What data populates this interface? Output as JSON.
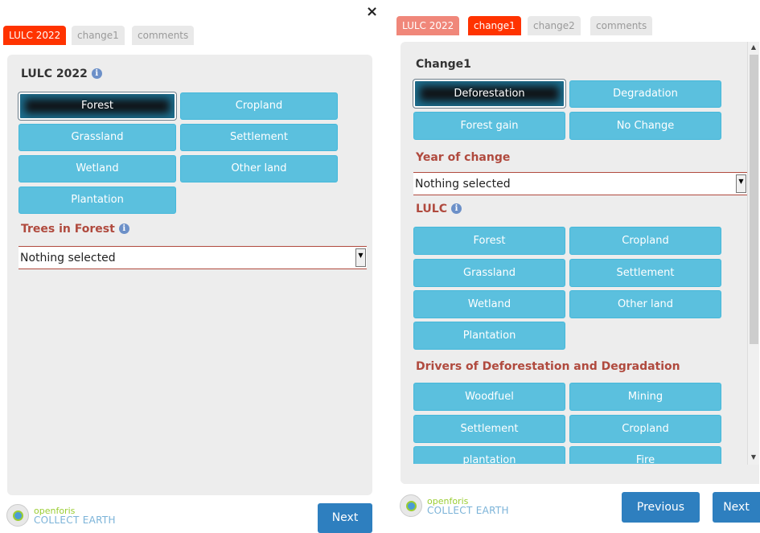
{
  "left": {
    "tabs": [
      {
        "label": "LULC 2022",
        "state": "active"
      },
      {
        "label": "change1",
        "state": "inactive"
      },
      {
        "label": "comments",
        "state": "inactive"
      }
    ],
    "section_title": "LULC 2022",
    "buttons": [
      "Forest",
      "Cropland",
      "Grassland",
      "Settlement",
      "Wetland",
      "Other land",
      "Plantation"
    ],
    "selected_button": "Forest",
    "trees_title": "Trees in Forest",
    "trees_select_value": "Nothing selected",
    "next_label": "Next"
  },
  "close_symbol": "×",
  "right": {
    "tabs": [
      {
        "label": "LULC 2022",
        "state": "visited"
      },
      {
        "label": "change1",
        "state": "active"
      },
      {
        "label": "change2",
        "state": "inactive"
      },
      {
        "label": "comments",
        "state": "inactive"
      }
    ],
    "section_title": "Change1",
    "change_buttons": [
      "Deforestation",
      "Degradation",
      "Forest gain",
      "No Change"
    ],
    "selected_change": "Deforestation",
    "year_title": "Year of change",
    "year_select_value": "Nothing selected",
    "lulc_title": "LULC",
    "lulc_buttons": [
      "Forest",
      "Cropland",
      "Grassland",
      "Settlement",
      "Wetland",
      "Other land",
      "Plantation"
    ],
    "drivers_title": "Drivers of Deforestation and Degradation",
    "driver_buttons": [
      "Woodfuel",
      "Mining",
      "Settlement",
      "Cropland",
      "plantation",
      "Fire"
    ],
    "previous_label": "Previous",
    "next_label": "Next"
  },
  "logo": {
    "line1": "openforis",
    "line2": "COLLECT EARTH"
  },
  "info_icon": "i",
  "colors": {
    "tab_active": "#ff3300",
    "button": "#5bc0de",
    "nav_button": "#2e7fbf",
    "section_red": "#b04a3e",
    "panel_bg": "#ededed"
  }
}
